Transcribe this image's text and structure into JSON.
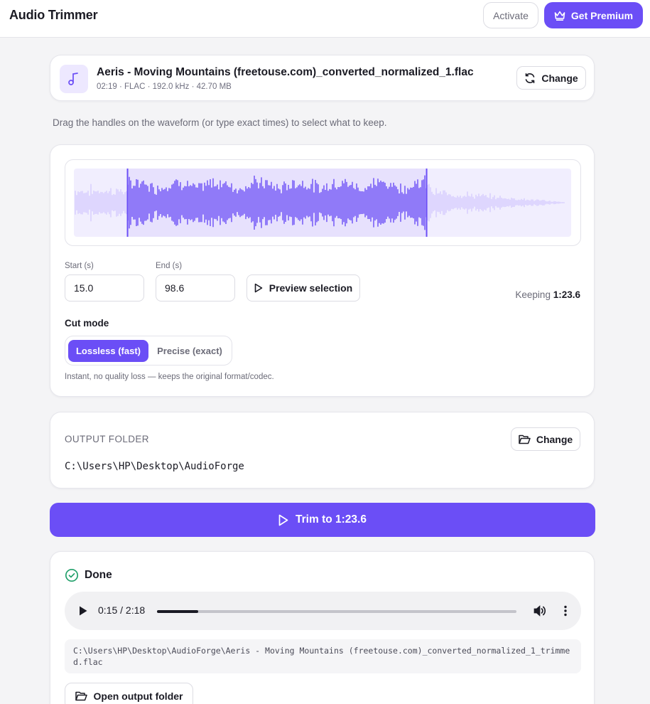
{
  "header": {
    "title": "Audio Trimmer",
    "activate_label": "Activate",
    "premium_label": "Get Premium"
  },
  "file": {
    "name": "Aeris - Moving Mountains (freetouse.com)_converted_normalized_1.flac",
    "meta": "02:19 · FLAC · 192.0 kHz · 42.70 MB",
    "change_label": "Change"
  },
  "hint": "Drag the handles on the waveform (or type exact times) to select what to keep.",
  "waveform": {
    "duration_s": 139,
    "selection_start_s": 15.0,
    "selection_end_s": 98.6,
    "colors": {
      "selected": "#6b4ef6",
      "unselected": "#d6ccff",
      "background": "#e7e1fd"
    }
  },
  "trim": {
    "start_label": "Start (s)",
    "start_value": "15.0",
    "end_label": "End (s)",
    "end_value": "98.6",
    "preview_label": "Preview selection",
    "keeping_label": "Keeping",
    "keeping_value": "1:23.6"
  },
  "cut_mode": {
    "title": "Cut mode",
    "options": [
      "Lossless (fast)",
      "Precise (exact)"
    ],
    "selected": "Lossless (fast)",
    "note": "Instant, no quality loss — keeps the original format/codec."
  },
  "output": {
    "label": "OUTPUT FOLDER",
    "change_label": "Change",
    "path": "C:\\Users\\HP\\Desktop\\AudioForge"
  },
  "trim_button_label": "Trim to 1:23.6",
  "result": {
    "title": "Done",
    "player_time": "0:15 / 2:18",
    "progress": 0.115,
    "output_file": "C:\\Users\\HP\\Desktop\\AudioForge\\Aeris - Moving Mountains (freetouse.com)_converted_normalized_1_trimmed.flac",
    "open_folder_label": "Open output folder"
  },
  "colors": {
    "accent": "#6b4ef6",
    "success": "#22a06b"
  }
}
